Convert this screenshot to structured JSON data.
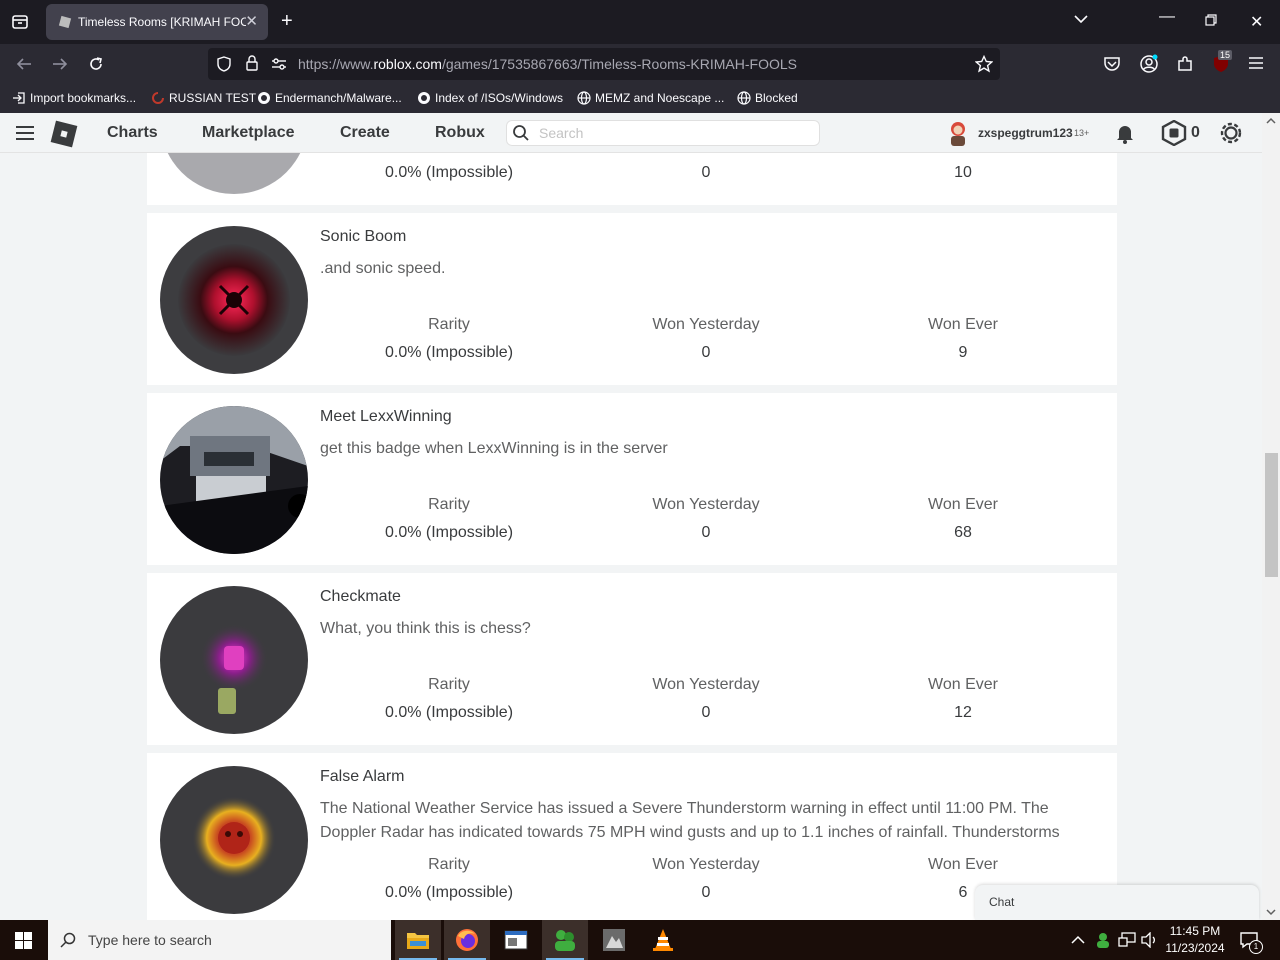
{
  "browser": {
    "tab_title": "Timeless Rooms [KRIMAH FOOLS",
    "url_prefix": "https://www.",
    "url_domain": "roblox.com",
    "url_path": "/games/17535867663/Timeless-Rooms-KRIMAH-FOOLS",
    "extension_badge": "15",
    "bookmarks": [
      {
        "label": "Import bookmarks...",
        "icon": "import-icon"
      },
      {
        "label": "RUSSIAN TEST",
        "icon": "loading-icon"
      },
      {
        "label": "Endermanch/Malware...",
        "icon": "chrome-icon"
      },
      {
        "label": "Index of /ISOs/Windows",
        "icon": "chrome-icon"
      },
      {
        "label": "MEMZ and Noescape ...",
        "icon": "globe-icon"
      },
      {
        "label": "Blocked",
        "icon": "globe-icon"
      }
    ]
  },
  "header": {
    "nav": [
      "Charts",
      "Marketplace",
      "Create",
      "Robux"
    ],
    "search_placeholder": "Search",
    "username": "zxspeggtrum123",
    "age_label": "13+",
    "robux_count": "0"
  },
  "stat_labels": {
    "rarity": "Rarity",
    "won_yesterday": "Won Yesterday",
    "won_ever": "Won Ever"
  },
  "top_partial": {
    "rarity": "0.0% (Impossible)",
    "won_yesterday": "0",
    "won_ever": "10"
  },
  "badges": [
    {
      "name": "Sonic Boom",
      "description": ".and sonic speed.",
      "rarity": "0.0% (Impossible)",
      "won_yesterday": "0",
      "won_ever": "9"
    },
    {
      "name": "Meet LexxWinning",
      "description": "get this badge when LexxWinning is in the server",
      "rarity": "0.0% (Impossible)",
      "won_yesterday": "0",
      "won_ever": "68"
    },
    {
      "name": "Checkmate",
      "description": "What, you think this is chess?",
      "rarity": "0.0% (Impossible)",
      "won_yesterday": "0",
      "won_ever": "12"
    },
    {
      "name": "False Alarm",
      "description": "The National Weather Service has issued a Severe Thunderstorm warning in effect until 11:00 PM. The Doppler Radar has indicated towards 75 MPH wind gusts and up to 1.1 inches of rainfall. Thunderstorms",
      "rarity": "0.0% (Impossible)",
      "won_yesterday": "0",
      "won_ever": "6"
    }
  ],
  "chat": {
    "label": "Chat"
  },
  "taskbar": {
    "search_placeholder": "Type here to search",
    "time": "11:45 PM",
    "date": "11/23/2024",
    "notification_count": "1"
  }
}
